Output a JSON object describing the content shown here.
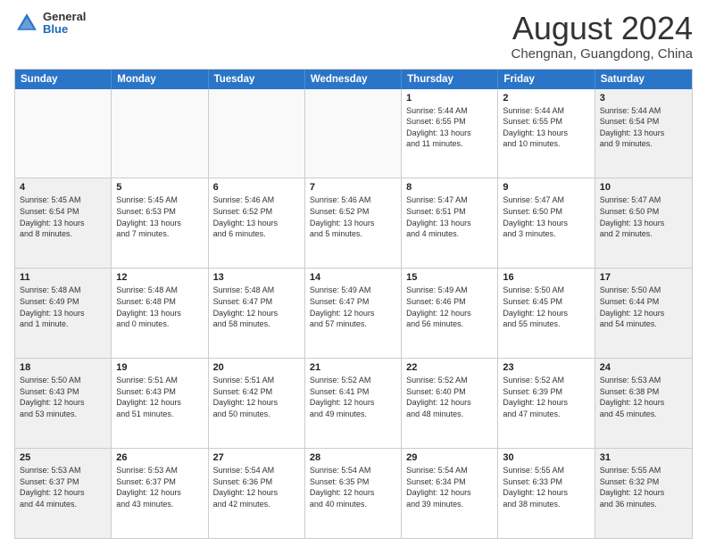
{
  "header": {
    "logo": {
      "general": "General",
      "blue": "Blue"
    },
    "month": "August 2024",
    "location": "Chengnan, Guangdong, China"
  },
  "weekdays": [
    "Sunday",
    "Monday",
    "Tuesday",
    "Wednesday",
    "Thursday",
    "Friday",
    "Saturday"
  ],
  "rows": [
    [
      {
        "day": "",
        "text": "",
        "empty": true
      },
      {
        "day": "",
        "text": "",
        "empty": true
      },
      {
        "day": "",
        "text": "",
        "empty": true
      },
      {
        "day": "",
        "text": "",
        "empty": true
      },
      {
        "day": "1",
        "text": "Sunrise: 5:44 AM\nSunset: 6:55 PM\nDaylight: 13 hours\nand 11 minutes."
      },
      {
        "day": "2",
        "text": "Sunrise: 5:44 AM\nSunset: 6:55 PM\nDaylight: 13 hours\nand 10 minutes."
      },
      {
        "day": "3",
        "text": "Sunrise: 5:44 AM\nSunset: 6:54 PM\nDaylight: 13 hours\nand 9 minutes.",
        "shaded": true
      }
    ],
    [
      {
        "day": "4",
        "text": "Sunrise: 5:45 AM\nSunset: 6:54 PM\nDaylight: 13 hours\nand 8 minutes.",
        "shaded": true
      },
      {
        "day": "5",
        "text": "Sunrise: 5:45 AM\nSunset: 6:53 PM\nDaylight: 13 hours\nand 7 minutes."
      },
      {
        "day": "6",
        "text": "Sunrise: 5:46 AM\nSunset: 6:52 PM\nDaylight: 13 hours\nand 6 minutes."
      },
      {
        "day": "7",
        "text": "Sunrise: 5:46 AM\nSunset: 6:52 PM\nDaylight: 13 hours\nand 5 minutes."
      },
      {
        "day": "8",
        "text": "Sunrise: 5:47 AM\nSunset: 6:51 PM\nDaylight: 13 hours\nand 4 minutes."
      },
      {
        "day": "9",
        "text": "Sunrise: 5:47 AM\nSunset: 6:50 PM\nDaylight: 13 hours\nand 3 minutes."
      },
      {
        "day": "10",
        "text": "Sunrise: 5:47 AM\nSunset: 6:50 PM\nDaylight: 13 hours\nand 2 minutes.",
        "shaded": true
      }
    ],
    [
      {
        "day": "11",
        "text": "Sunrise: 5:48 AM\nSunset: 6:49 PM\nDaylight: 13 hours\nand 1 minute.",
        "shaded": true
      },
      {
        "day": "12",
        "text": "Sunrise: 5:48 AM\nSunset: 6:48 PM\nDaylight: 13 hours\nand 0 minutes."
      },
      {
        "day": "13",
        "text": "Sunrise: 5:48 AM\nSunset: 6:47 PM\nDaylight: 12 hours\nand 58 minutes."
      },
      {
        "day": "14",
        "text": "Sunrise: 5:49 AM\nSunset: 6:47 PM\nDaylight: 12 hours\nand 57 minutes."
      },
      {
        "day": "15",
        "text": "Sunrise: 5:49 AM\nSunset: 6:46 PM\nDaylight: 12 hours\nand 56 minutes."
      },
      {
        "day": "16",
        "text": "Sunrise: 5:50 AM\nSunset: 6:45 PM\nDaylight: 12 hours\nand 55 minutes."
      },
      {
        "day": "17",
        "text": "Sunrise: 5:50 AM\nSunset: 6:44 PM\nDaylight: 12 hours\nand 54 minutes.",
        "shaded": true
      }
    ],
    [
      {
        "day": "18",
        "text": "Sunrise: 5:50 AM\nSunset: 6:43 PM\nDaylight: 12 hours\nand 53 minutes.",
        "shaded": true
      },
      {
        "day": "19",
        "text": "Sunrise: 5:51 AM\nSunset: 6:43 PM\nDaylight: 12 hours\nand 51 minutes."
      },
      {
        "day": "20",
        "text": "Sunrise: 5:51 AM\nSunset: 6:42 PM\nDaylight: 12 hours\nand 50 minutes."
      },
      {
        "day": "21",
        "text": "Sunrise: 5:52 AM\nSunset: 6:41 PM\nDaylight: 12 hours\nand 49 minutes."
      },
      {
        "day": "22",
        "text": "Sunrise: 5:52 AM\nSunset: 6:40 PM\nDaylight: 12 hours\nand 48 minutes."
      },
      {
        "day": "23",
        "text": "Sunrise: 5:52 AM\nSunset: 6:39 PM\nDaylight: 12 hours\nand 47 minutes."
      },
      {
        "day": "24",
        "text": "Sunrise: 5:53 AM\nSunset: 6:38 PM\nDaylight: 12 hours\nand 45 minutes.",
        "shaded": true
      }
    ],
    [
      {
        "day": "25",
        "text": "Sunrise: 5:53 AM\nSunset: 6:37 PM\nDaylight: 12 hours\nand 44 minutes.",
        "shaded": true
      },
      {
        "day": "26",
        "text": "Sunrise: 5:53 AM\nSunset: 6:37 PM\nDaylight: 12 hours\nand 43 minutes."
      },
      {
        "day": "27",
        "text": "Sunrise: 5:54 AM\nSunset: 6:36 PM\nDaylight: 12 hours\nand 42 minutes."
      },
      {
        "day": "28",
        "text": "Sunrise: 5:54 AM\nSunset: 6:35 PM\nDaylight: 12 hours\nand 40 minutes."
      },
      {
        "day": "29",
        "text": "Sunrise: 5:54 AM\nSunset: 6:34 PM\nDaylight: 12 hours\nand 39 minutes."
      },
      {
        "day": "30",
        "text": "Sunrise: 5:55 AM\nSunset: 6:33 PM\nDaylight: 12 hours\nand 38 minutes."
      },
      {
        "day": "31",
        "text": "Sunrise: 5:55 AM\nSunset: 6:32 PM\nDaylight: 12 hours\nand 36 minutes.",
        "shaded": true
      }
    ]
  ]
}
